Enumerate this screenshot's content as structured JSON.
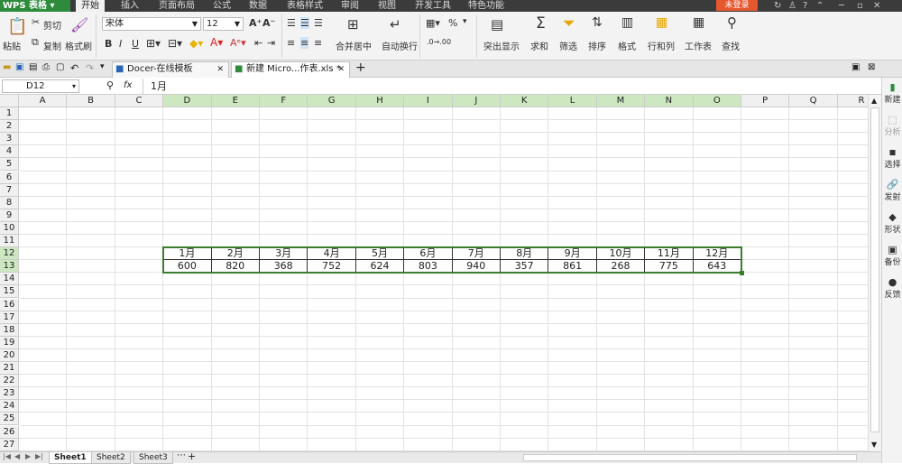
{
  "app": {
    "brand": "WPS 表格"
  },
  "menu": {
    "tabs": [
      "开始",
      "插入",
      "页面布局",
      "公式",
      "数据",
      "表格样式",
      "审阅",
      "视图",
      "开发工具",
      "特色功能"
    ],
    "login": "未登录"
  },
  "ribbon": {
    "paste": "粘贴",
    "cut": "剪切",
    "copy": "复制",
    "format_painter": "格式刷",
    "font_name": "宋体",
    "font_size": "12",
    "merge_center": "合并居中",
    "auto_wrap": "自动换行",
    "highlight": "突出显示",
    "sum": "求和",
    "filter": "筛选",
    "sort": "排序",
    "format": "格式",
    "row_col": "行和列",
    "worksheet": "工作表",
    "find": "查找"
  },
  "docs": {
    "tab1": "Docer-在线模板",
    "tab2": "新建 Micro...作表.xls *"
  },
  "formula": {
    "cell_ref": "D12",
    "fx": "fx",
    "content": "1月"
  },
  "grid": {
    "columns": [
      "A",
      "B",
      "C",
      "D",
      "E",
      "F",
      "G",
      "H",
      "I",
      "J",
      "K",
      "L",
      "M",
      "N",
      "O",
      "P",
      "Q",
      "R"
    ],
    "rows": [
      "1",
      "2",
      "3",
      "4",
      "5",
      "6",
      "7",
      "8",
      "9",
      "10",
      "11",
      "12",
      "13",
      "14",
      "15",
      "16",
      "17",
      "18",
      "19",
      "20",
      "21",
      "22",
      "23",
      "24",
      "25",
      "26",
      "27"
    ],
    "months": [
      "1月",
      "2月",
      "3月",
      "4月",
      "5月",
      "6月",
      "7月",
      "8月",
      "9月",
      "10月",
      "11月",
      "12月"
    ],
    "values": [
      "600",
      "820",
      "368",
      "752",
      "624",
      "803",
      "940",
      "357",
      "861",
      "268",
      "775",
      "643"
    ]
  },
  "sidebar": [
    "新建",
    "分析",
    "选择",
    "发射",
    "形状",
    "备份",
    "反馈"
  ],
  "sheets": [
    "Sheet1",
    "Sheet2",
    "Sheet3"
  ],
  "colors": {
    "brand": "#2e8b3c",
    "selection": "#3a7d2c",
    "selected_header": "#cde8c0",
    "login": "#e5572e"
  }
}
